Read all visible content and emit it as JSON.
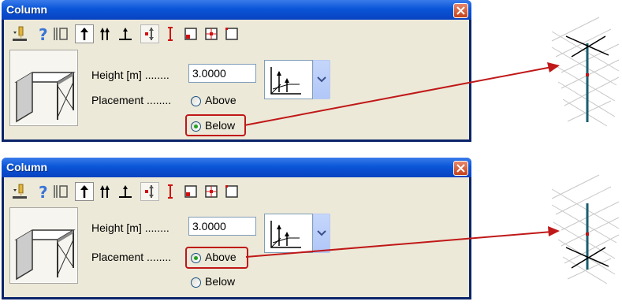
{
  "dialogs": [
    {
      "title": "Column",
      "height_label": "Height [m] ........",
      "height_value": "3.0000",
      "placement_label": "Placement ........",
      "option_above": "Above",
      "option_below": "Below",
      "selected": "Below"
    },
    {
      "title": "Column",
      "height_label": "Height [m] ........",
      "height_value": "3.0000",
      "placement_label": "Placement ........",
      "option_above": "Above",
      "option_below": "Below",
      "selected": "Above"
    }
  ],
  "toolbar_icons": [
    "pencil-dropdown-icon",
    "help-icon",
    "column-frame-icon",
    "column-up-arrow-icon",
    "column-double-arrow-icon",
    "column-base-icon",
    "column-center-icon",
    "column-red-icon",
    "square-point-icon",
    "grid-point-icon",
    "square-corner-icon"
  ],
  "colors": {
    "titlebar": "#0a56d8",
    "face": "#ece9d8",
    "highlight": "#c01818",
    "column": "#1b5e6e"
  }
}
